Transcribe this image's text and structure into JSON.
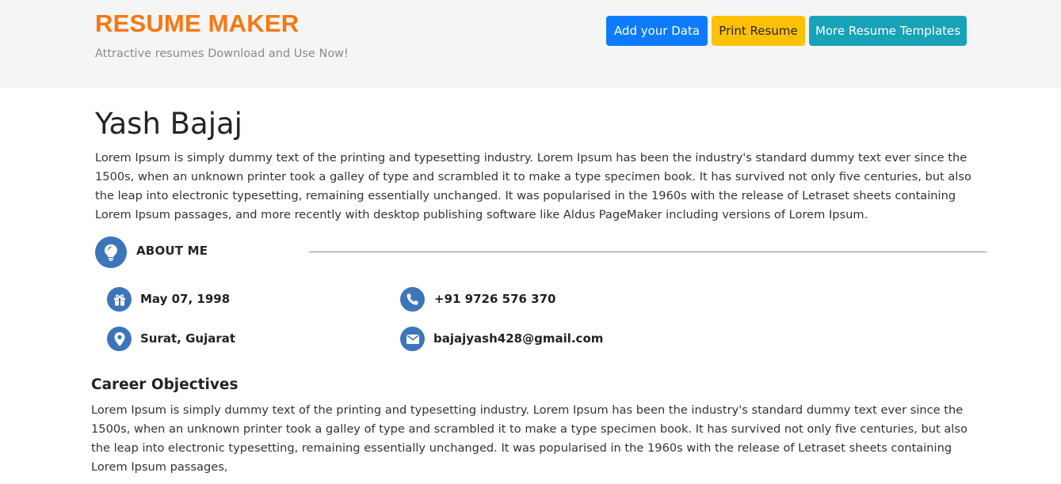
{
  "header": {
    "brand": "RESUME MAKER",
    "tagline": "Attractive resumes Download and Use Now!",
    "buttons": {
      "add": "Add your Data",
      "print": "Print Resume",
      "more": "More Resume Templates"
    }
  },
  "profile": {
    "name": "Yash Bajaj",
    "intro": "Lorem Ipsum is simply dummy text of the printing and typesetting industry. Lorem Ipsum has been the industry's standard dummy text ever since the 1500s, when an unknown printer took a galley of type and scrambled it to make a type specimen book. It has survived not only five centuries, but also the leap into electronic typesetting, remaining essentially unchanged. It was popularised in the 1960s with the release of Letraset sheets containing Lorem Ipsum passages, and more recently with desktop publishing software like Aldus PageMaker including versions of Lorem Ipsum."
  },
  "about": {
    "title": "ABOUT ME",
    "icon": "lightbulb-icon",
    "items": {
      "dob": {
        "icon": "gift-icon",
        "value": "May 07, 1998"
      },
      "phone": {
        "icon": "phone-icon",
        "value": "+91 9726 576 370"
      },
      "location": {
        "icon": "map-marker-icon",
        "value": "Surat, Gujarat"
      },
      "email": {
        "icon": "envelope-icon",
        "value": "bajajyash428@gmail.com"
      }
    }
  },
  "career": {
    "title": "Career Objectives",
    "text": "Lorem Ipsum is simply dummy text of the printing and typesetting industry. Lorem Ipsum has been the industry's standard dummy text ever since the 1500s, when an unknown printer took a galley of type and scrambled it to make a type specimen book. It has survived not only five centuries, but also the leap into electronic typesetting, remaining essentially unchanged. It was popularised in the 1960s with the release of Letraset sheets containing Lorem Ipsum passages,"
  },
  "colors": {
    "brand": "#f7770f",
    "primary_button": "#0d7bfc",
    "warning_button": "#ffc107",
    "info_button": "#17a2b8",
    "icon_circle": "#3c75b9"
  }
}
